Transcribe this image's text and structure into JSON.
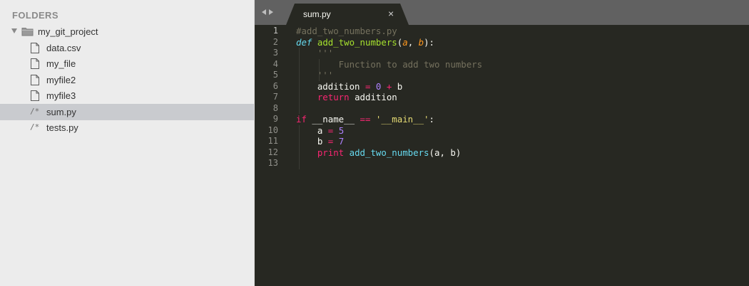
{
  "sidebar": {
    "heading": "FOLDERS",
    "project": {
      "name": "my_git_project",
      "icon": "folder-icon",
      "disclosure": "triangle-down-icon"
    },
    "files": [
      {
        "name": "data.csv",
        "icon": "file-icon",
        "selected": false
      },
      {
        "name": "my_file",
        "icon": "file-icon",
        "selected": false
      },
      {
        "name": "myfile2",
        "icon": "file-icon",
        "selected": false
      },
      {
        "name": "myfile3",
        "icon": "file-icon",
        "selected": false
      },
      {
        "name": "sum.py",
        "icon": "python-file-icon",
        "icon_glyph": "/*",
        "selected": true
      },
      {
        "name": "tests.py",
        "icon": "python-file-icon",
        "icon_glyph": "/*",
        "selected": false
      }
    ]
  },
  "tabbar": {
    "nav_back_icon": "arrow-left-icon",
    "nav_forward_icon": "arrow-right-icon",
    "tab": {
      "title": "sum.py",
      "close": "×"
    }
  },
  "editor": {
    "current_line": 1,
    "lines": [
      {
        "n": "1",
        "tokens": [
          {
            "t": "#add_two_numbers.py",
            "c": "comment"
          }
        ]
      },
      {
        "n": "2",
        "tokens": [
          {
            "t": "def",
            "c": "storage"
          },
          {
            "t": " ",
            "c": "plain"
          },
          {
            "t": "add_two_numbers",
            "c": "fname"
          },
          {
            "t": "(",
            "c": "plain"
          },
          {
            "t": "a",
            "c": "param"
          },
          {
            "t": ", ",
            "c": "plain"
          },
          {
            "t": "b",
            "c": "param"
          },
          {
            "t": "):",
            "c": "plain"
          }
        ]
      },
      {
        "n": "3",
        "tokens": [
          {
            "t": "    '''",
            "c": "comment"
          }
        ]
      },
      {
        "n": "4",
        "tokens": [
          {
            "t": "        Function to add two numbers",
            "c": "comment"
          }
        ]
      },
      {
        "n": "5",
        "tokens": [
          {
            "t": "    '''",
            "c": "comment"
          }
        ]
      },
      {
        "n": "6",
        "tokens": [
          {
            "t": "    addition ",
            "c": "plain"
          },
          {
            "t": "=",
            "c": "op"
          },
          {
            "t": " ",
            "c": "plain"
          },
          {
            "t": "0",
            "c": "number"
          },
          {
            "t": " ",
            "c": "plain"
          },
          {
            "t": "+",
            "c": "op"
          },
          {
            "t": " b",
            "c": "plain"
          }
        ]
      },
      {
        "n": "7",
        "tokens": [
          {
            "t": "    ",
            "c": "plain"
          },
          {
            "t": "return",
            "c": "keyword"
          },
          {
            "t": " addition",
            "c": "plain"
          }
        ]
      },
      {
        "n": "8",
        "tokens": []
      },
      {
        "n": "9",
        "tokens": [
          {
            "t": "if",
            "c": "keyword"
          },
          {
            "t": " __name__ ",
            "c": "plain"
          },
          {
            "t": "==",
            "c": "op"
          },
          {
            "t": " ",
            "c": "plain"
          },
          {
            "t": "'__main__'",
            "c": "string"
          },
          {
            "t": ":",
            "c": "plain"
          }
        ]
      },
      {
        "n": "10",
        "tokens": [
          {
            "t": "    a ",
            "c": "plain"
          },
          {
            "t": "=",
            "c": "op"
          },
          {
            "t": " ",
            "c": "plain"
          },
          {
            "t": "5",
            "c": "number"
          }
        ]
      },
      {
        "n": "11",
        "tokens": [
          {
            "t": "    b ",
            "c": "plain"
          },
          {
            "t": "=",
            "c": "op"
          },
          {
            "t": " ",
            "c": "plain"
          },
          {
            "t": "7",
            "c": "number"
          }
        ]
      },
      {
        "n": "12",
        "tokens": [
          {
            "t": "    ",
            "c": "plain"
          },
          {
            "t": "print",
            "c": "keyword"
          },
          {
            "t": " ",
            "c": "plain"
          },
          {
            "t": "add_two_numbers",
            "c": "func"
          },
          {
            "t": "(a, b)",
            "c": "plain"
          }
        ]
      },
      {
        "n": "13",
        "tokens": []
      }
    ]
  },
  "colors": {
    "editor_bg": "#272822",
    "sidebar_bg": "#ececec",
    "selected_row": "#c9cbcf",
    "comment": "#75715e",
    "keyword": "#f92672",
    "function_name": "#a6e22e",
    "parameter": "#fd971f",
    "number": "#ae81ff",
    "string": "#e6db74",
    "builtin": "#66d9ef"
  }
}
